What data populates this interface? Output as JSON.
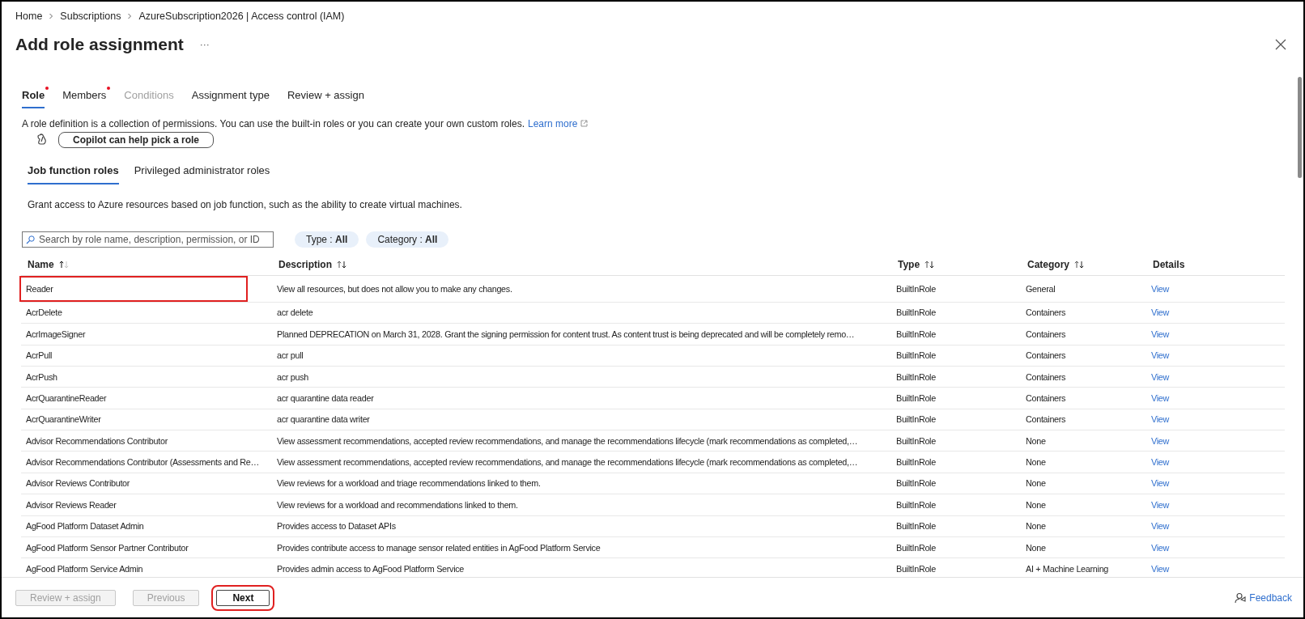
{
  "breadcrumb": [
    "Home",
    "Subscriptions",
    "AzureSubscription2026 | Access control (IAM)"
  ],
  "title": "Add role assignment",
  "more": "···",
  "tabs": [
    {
      "label": "Role",
      "selected": true,
      "required": true,
      "disabled": false
    },
    {
      "label": "Members",
      "selected": false,
      "required": true,
      "disabled": false
    },
    {
      "label": "Conditions",
      "selected": false,
      "required": false,
      "disabled": true
    },
    {
      "label": "Assignment type",
      "selected": false,
      "required": false,
      "disabled": false
    },
    {
      "label": "Review + assign",
      "selected": false,
      "required": false,
      "disabled": false
    }
  ],
  "intro": {
    "text": "A role definition is a collection of permissions. You can use the built-in roles or you can create your own custom roles.",
    "link": "Learn more"
  },
  "copilot_button": "Copilot can help pick a role",
  "role_tabs": [
    {
      "label": "Job function roles",
      "selected": true
    },
    {
      "label": "Privileged administrator roles",
      "selected": false
    }
  ],
  "role_tab_description": "Grant access to Azure resources based on job function, such as the ability to create virtual machines.",
  "search": {
    "placeholder": "Search by role name, description, permission, or ID"
  },
  "filters": [
    {
      "label": "Type : ",
      "value": "All"
    },
    {
      "label": "Category : ",
      "value": "All"
    }
  ],
  "table": {
    "columns": [
      {
        "label": "Name",
        "sortable": true,
        "sorted_ascending": true
      },
      {
        "label": "Description",
        "sortable": true,
        "sorted_ascending": false
      },
      {
        "label": "Type",
        "sortable": true,
        "sorted_ascending": false
      },
      {
        "label": "Category",
        "sortable": true,
        "sorted_ascending": false
      },
      {
        "label": "Details",
        "sortable": false
      }
    ],
    "rows": [
      {
        "name": "Reader",
        "description": "View all resources, but does not allow you to make any changes.",
        "type": "BuiltInRole",
        "category": "General",
        "details": "View",
        "highlighted": true
      },
      {
        "name": "AcrDelete",
        "description": "acr delete",
        "type": "BuiltInRole",
        "category": "Containers",
        "details": "View",
        "highlighted": false
      },
      {
        "name": "AcrImageSigner",
        "description": "Planned DEPRECATION on March 31, 2028. Grant the signing permission for content trust. As content trust is being deprecated and will be completely remo…",
        "type": "BuiltInRole",
        "category": "Containers",
        "details": "View",
        "highlighted": false
      },
      {
        "name": "AcrPull",
        "description": "acr pull",
        "type": "BuiltInRole",
        "category": "Containers",
        "details": "View",
        "highlighted": false
      },
      {
        "name": "AcrPush",
        "description": "acr push",
        "type": "BuiltInRole",
        "category": "Containers",
        "details": "View",
        "highlighted": false
      },
      {
        "name": "AcrQuarantineReader",
        "description": "acr quarantine data reader",
        "type": "BuiltInRole",
        "category": "Containers",
        "details": "View",
        "highlighted": false
      },
      {
        "name": "AcrQuarantineWriter",
        "description": "acr quarantine data writer",
        "type": "BuiltInRole",
        "category": "Containers",
        "details": "View",
        "highlighted": false
      },
      {
        "name": "Advisor Recommendations Contributor",
        "description": "View assessment recommendations, accepted review recommendations, and manage the recommendations lifecycle (mark recommendations as completed,…",
        "type": "BuiltInRole",
        "category": "None",
        "details": "View",
        "highlighted": false
      },
      {
        "name": "Advisor Recommendations Contributor (Assessments and Re…",
        "description": "View assessment recommendations, accepted review recommendations, and manage the recommendations lifecycle (mark recommendations as completed,…",
        "type": "BuiltInRole",
        "category": "None",
        "details": "View",
        "highlighted": false
      },
      {
        "name": "Advisor Reviews Contributor",
        "description": "View reviews for a workload and triage recommendations linked to them.",
        "type": "BuiltInRole",
        "category": "None",
        "details": "View",
        "highlighted": false
      },
      {
        "name": "Advisor Reviews Reader",
        "description": "View reviews for a workload and recommendations linked to them.",
        "type": "BuiltInRole",
        "category": "None",
        "details": "View",
        "highlighted": false
      },
      {
        "name": "AgFood Platform Dataset Admin",
        "description": "Provides access to Dataset APIs",
        "type": "BuiltInRole",
        "category": "None",
        "details": "View",
        "highlighted": false
      },
      {
        "name": "AgFood Platform Sensor Partner Contributor",
        "description": "Provides contribute access to manage sensor related entities in AgFood Platform Service",
        "type": "BuiltInRole",
        "category": "None",
        "details": "View",
        "highlighted": false
      },
      {
        "name": "AgFood Platform Service Admin",
        "description": "Provides admin access to AgFood Platform Service",
        "type": "BuiltInRole",
        "category": "AI + Machine Learning",
        "details": "View",
        "highlighted": false
      }
    ]
  },
  "footer_buttons": [
    {
      "label": "Review + assign",
      "disabled": true,
      "highlighted": false
    },
    {
      "label": "Previous",
      "disabled": true,
      "highlighted": false
    },
    {
      "label": "Next",
      "disabled": false,
      "highlighted": true
    }
  ],
  "feedback": "Feedback"
}
